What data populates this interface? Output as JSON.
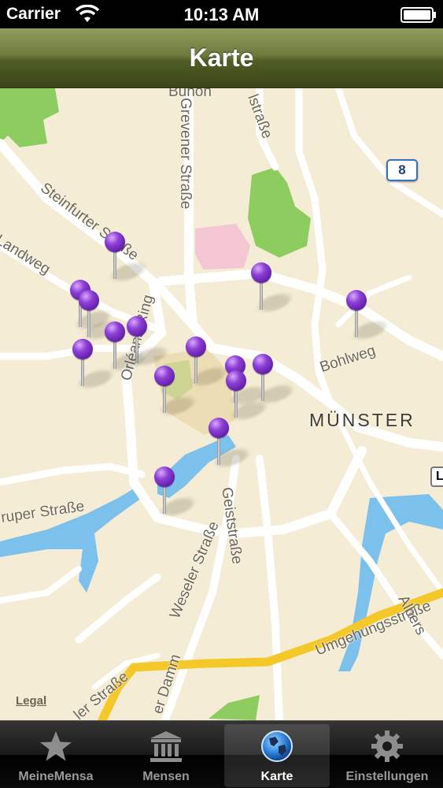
{
  "status_bar": {
    "carrier": "Carrier",
    "time": "10:13 AM"
  },
  "nav_bar": {
    "title": "Karte"
  },
  "map": {
    "city_label": "MÜNSTER",
    "streets": {
      "steinfurter": "Steinfurter Straße",
      "grevener": "Grevener Straße",
      "landweg": "Landweg",
      "orleans_ring": "Orléans-Ring",
      "bohlweg": "Bohlweg",
      "weseler": "Weseler Straße",
      "geiststrasse": "Geiststraße",
      "umgehungsstrasse": "Umgehungsstraße",
      "albers": "Albers",
      "kruper": "ruper Straße",
      "damm": "er Damm",
      "ler_strasse": "ler Straße",
      "top_strasse": "lstraße",
      "buhon": "Buhon"
    },
    "route_shield": "8",
    "edge_shield": "L",
    "legal": "Legal",
    "pin_count": 16,
    "colors": {
      "land": "#f4ecd4",
      "road": "#ffffff",
      "park": "#8dcc5e",
      "water": "#7cc0ec",
      "highway": "#f5c82a",
      "pin": "#7a2fc4"
    }
  },
  "tab_bar": {
    "tabs": [
      {
        "label": "MeineMensa",
        "icon": "star-icon",
        "selected": false
      },
      {
        "label": "Mensen",
        "icon": "building-icon",
        "selected": false
      },
      {
        "label": "Karte",
        "icon": "globe-icon",
        "selected": true
      },
      {
        "label": "Einstellungen",
        "icon": "gear-icon",
        "selected": false
      }
    ]
  }
}
